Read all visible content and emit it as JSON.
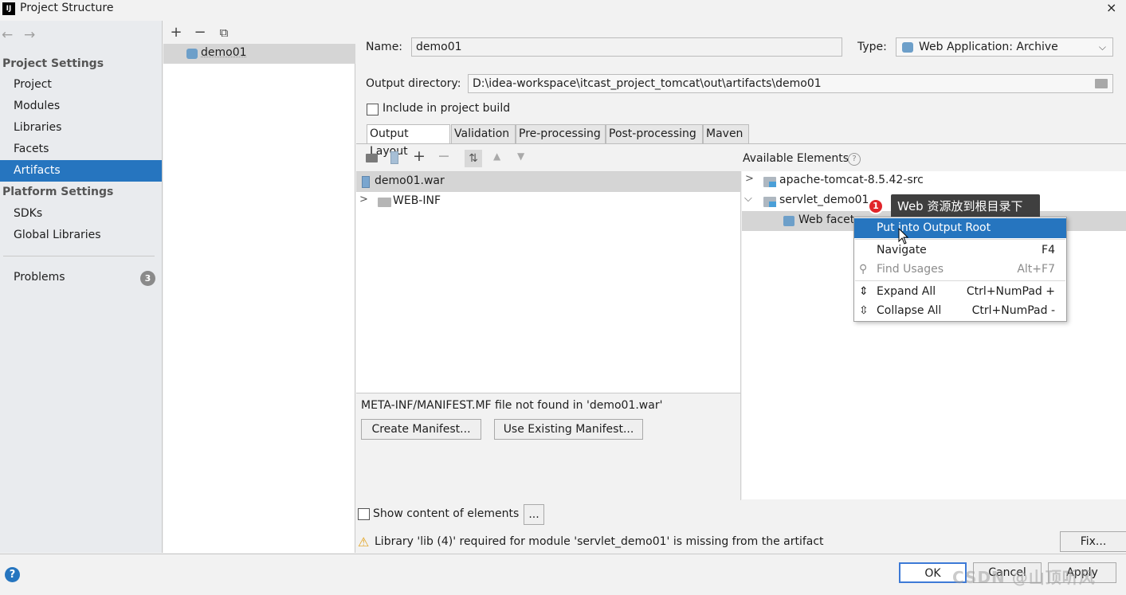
{
  "window": {
    "icon": "IJ",
    "title": "Project Structure",
    "close": "×"
  },
  "nav": {
    "back": "←",
    "forward": "→",
    "project_settings_header": "Project Settings",
    "project_items": [
      "Project",
      "Modules",
      "Libraries",
      "Facets",
      "Artifacts"
    ],
    "active_item": "Artifacts",
    "platform_settings_header": "Platform Settings",
    "platform_items": [
      "SDKs",
      "Global Libraries"
    ],
    "problems_label": "Problems",
    "problems_count": "3"
  },
  "artifact_list": {
    "toolbar": {
      "add": "+",
      "remove": "−",
      "copy": "⧉"
    },
    "items": [
      "demo01"
    ]
  },
  "form": {
    "name_label": "Name:",
    "name_value": "demo01",
    "type_label": "Type:",
    "type_value": "Web Application: Archive",
    "output_dir_label": "Output directory:",
    "output_dir_value": "D:\\idea-workspace\\itcast_project_tomcat\\out\\artifacts\\demo01",
    "include_build_label": "Include in project build",
    "include_build_checked": false
  },
  "tabs": [
    "Output Layout",
    "Validation",
    "Pre-processing",
    "Post-processing",
    "Maven"
  ],
  "active_tab": "Output Layout",
  "layout_tree": {
    "root": "demo01.war",
    "children": [
      "WEB-INF"
    ]
  },
  "available_elements": {
    "header": "Available Elements",
    "help": "?",
    "items": [
      "apache-tomcat-8.5.42-src",
      "servlet_demo01",
      "Web facet"
    ]
  },
  "context_menu": {
    "items": [
      {
        "label": "Put into Output Root",
        "shortcut": ""
      },
      {
        "label": "Navigate",
        "shortcut": "F4"
      },
      {
        "label": "Find Usages",
        "shortcut": "Alt+F7"
      },
      {
        "label": "Expand All",
        "shortcut": "Ctrl+NumPad +"
      },
      {
        "label": "Collapse All",
        "shortcut": "Ctrl+NumPad -"
      }
    ]
  },
  "annotation": {
    "badge": "1",
    "text": "Web 资源放到根目录下"
  },
  "manifest": {
    "message": "META-INF/MANIFEST.MF file not found in 'demo01.war'",
    "create_button": "Create Manifest...",
    "use_existing_button": "Use Existing Manifest..."
  },
  "show_content": {
    "label": "Show content of elements",
    "more": "..."
  },
  "warning": {
    "icon": "⚠",
    "text": "Library 'lib (4)' required for module 'servlet_demo01' is missing from the artifact",
    "fix_button": "Fix..."
  },
  "footer": {
    "help": "?",
    "ok": "OK",
    "cancel": "Cancel",
    "apply": "Apply"
  },
  "watermark": "CSDN @山顶听风"
}
